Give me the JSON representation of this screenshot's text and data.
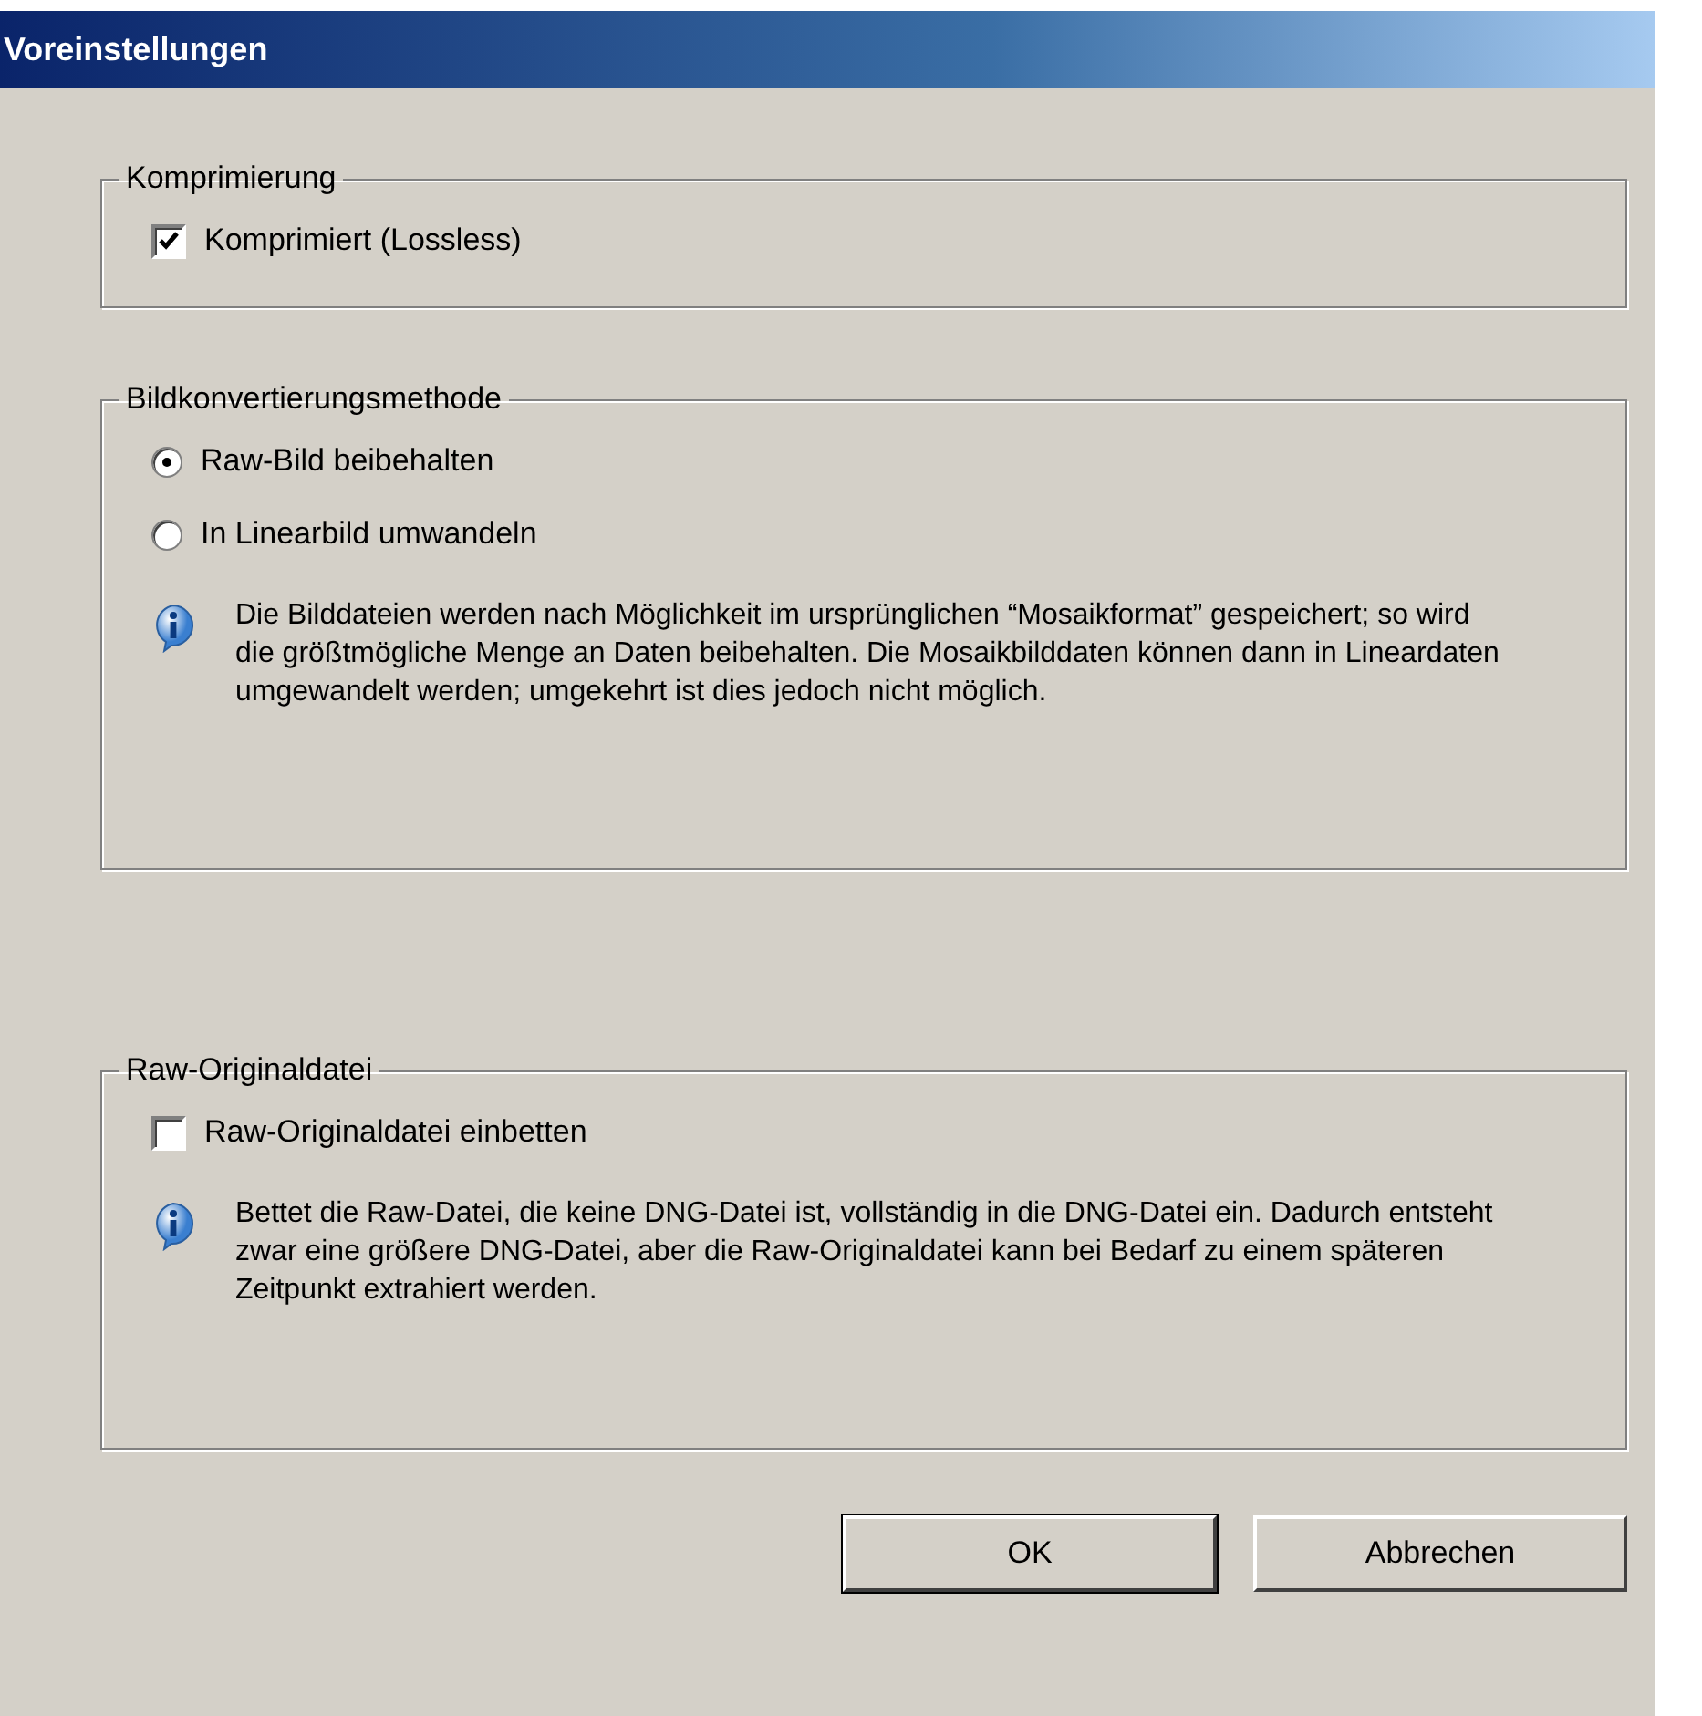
{
  "window": {
    "title": "Voreinstellungen"
  },
  "groups": [
    {
      "title": "Komprimierung",
      "items": [
        {
          "kind": "checkbox",
          "label": "Komprimiert (Lossless)",
          "checked": true
        }
      ]
    },
    {
      "title": "Bildkonvertierungsmethode",
      "items": [
        {
          "kind": "radio",
          "label": "Raw-Bild beibehalten",
          "selected": true
        },
        {
          "kind": "radio",
          "label": "In Linearbild umwandeln",
          "selected": false
        },
        {
          "kind": "info",
          "text": "Die Bilddateien werden nach Möglichkeit im ursprünglichen “Mosaikformat” gespeichert; so wird die größtmögliche Menge an Daten beibehalten.  Die Mosaikbilddaten können dann in Lineardaten umgewandelt werden; umgekehrt ist dies jedoch nicht möglich."
        }
      ]
    },
    {
      "title": "Raw-Originaldatei",
      "items": [
        {
          "kind": "checkbox",
          "label": "Raw-Originaldatei einbetten",
          "checked": false
        },
        {
          "kind": "info",
          "text": "Bettet die Raw-Datei, die keine DNG-Datei ist, vollständig in die DNG-Datei ein. Dadurch entsteht zwar eine größere DNG-Datei, aber die Raw-Originaldatei kann bei Bedarf zu einem späteren Zeitpunkt extrahiert werden."
        }
      ]
    }
  ],
  "buttons": [
    {
      "label": "OK",
      "default": true
    },
    {
      "label": "Abbrechen",
      "default": false
    }
  ]
}
